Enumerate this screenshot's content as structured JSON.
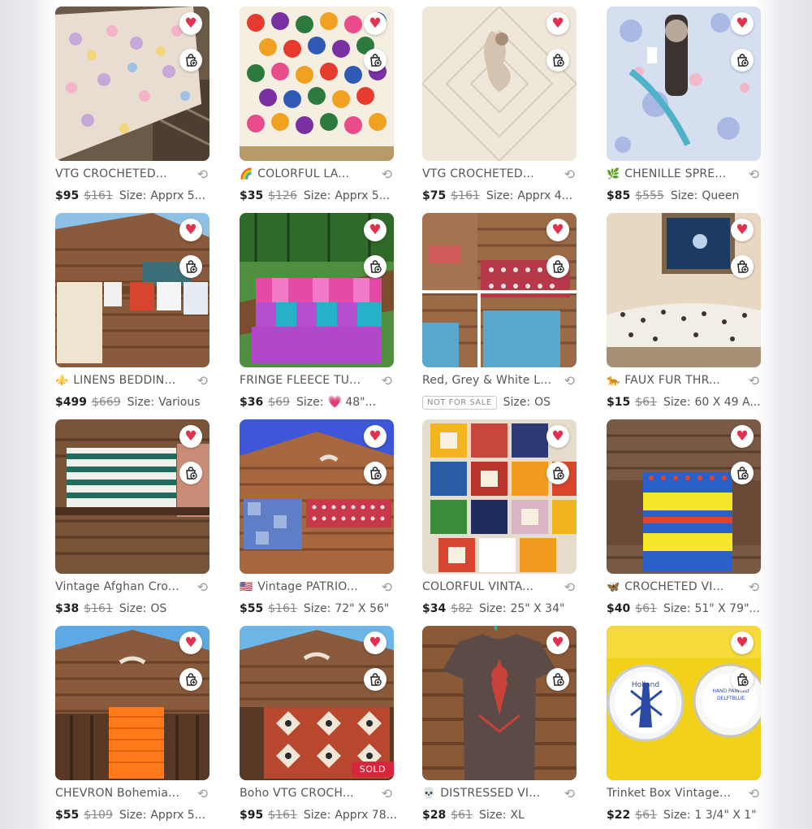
{
  "listings": [
    {
      "title": "VTG CROCHETED...",
      "emoji": "",
      "price": "$95",
      "original_price": "$161",
      "size_label": "Size:",
      "size": "Apprx 5...",
      "not_for_sale": "",
      "sold": ""
    },
    {
      "title": "COLORFUL  LA...",
      "emoji": "🌈",
      "price": "$35",
      "original_price": "$126",
      "size_label": "Size:",
      "size": "Apprx 5...",
      "not_for_sale": "",
      "sold": ""
    },
    {
      "title": "VTG CROCHETED...",
      "emoji": "",
      "price": "$75",
      "original_price": "$161",
      "size_label": "Size:",
      "size": "Apprx  4...",
      "not_for_sale": "",
      "sold": ""
    },
    {
      "title": "CHENILLE SPRE...",
      "emoji": "🌿",
      "price": "$85",
      "original_price": "$555",
      "size_label": "Size:",
      "size": "Queen",
      "not_for_sale": "",
      "sold": ""
    },
    {
      "title": "LINENS BEDDIN...",
      "emoji": "⚜️",
      "price": "$499",
      "original_price": "$669",
      "size_label": "Size:",
      "size": "Various",
      "not_for_sale": "",
      "sold": ""
    },
    {
      "title": "FRINGE FLEECE TU...",
      "emoji": "",
      "price": "$36",
      "original_price": "$69",
      "size_label": "Size:",
      "size": "💗    48\"...",
      "not_for_sale": "",
      "sold": ""
    },
    {
      "title": "Red, Grey & White L...",
      "emoji": "",
      "price": "",
      "original_price": "",
      "size_label": "Size:",
      "size": "OS",
      "not_for_sale": "NOT FOR SALE",
      "sold": ""
    },
    {
      "title": "FAUX FUR THR...",
      "emoji": "🐆",
      "price": "$15",
      "original_price": "$61",
      "size_label": "Size:",
      "size": "60 X 49 A...",
      "not_for_sale": "",
      "sold": ""
    },
    {
      "title": "Vintage Afghan Cro...",
      "emoji": "",
      "price": "$38",
      "original_price": "$161",
      "size_label": "Size:",
      "size": "OS",
      "not_for_sale": "",
      "sold": ""
    },
    {
      "title": "Vintage PATRIO...",
      "emoji": "🇺🇸",
      "price": "$55",
      "original_price": "$161",
      "size_label": "Size:",
      "size": "72\" X 56\"",
      "not_for_sale": "",
      "sold": ""
    },
    {
      "title": "COLORFUL  VINTA...",
      "emoji": "",
      "price": "$34",
      "original_price": "$82",
      "size_label": "Size:",
      "size": "25\" X 34\"",
      "not_for_sale": "",
      "sold": ""
    },
    {
      "title": "CROCHETED VI...",
      "emoji": "🦋",
      "price": "$40",
      "original_price": "$61",
      "size_label": "Size:",
      "size": "51\" X 79\"...",
      "not_for_sale": "",
      "sold": ""
    },
    {
      "title": "CHEVRON Bohemia...",
      "emoji": "",
      "price": "$55",
      "original_price": "$109",
      "size_label": "Size:",
      "size": "Apprx 5...",
      "not_for_sale": "",
      "sold": ""
    },
    {
      "title": "Boho VTG CROCH...",
      "emoji": "",
      "price": "$95",
      "original_price": "$161",
      "size_label": "Size:",
      "size": "Apprx 78...",
      "not_for_sale": "",
      "sold": "SOLD"
    },
    {
      "title": "DISTRESSED VI...",
      "emoji": "💀",
      "price": "$28",
      "original_price": "$61",
      "size_label": "Size:",
      "size": "XL",
      "not_for_sale": "",
      "sold": ""
    },
    {
      "title": "Trinket Box Vintage...",
      "emoji": "",
      "price": "$22",
      "original_price": "$61",
      "size_label": "Size:",
      "size": "1 3/4\"  X  1\"",
      "not_for_sale": "",
      "sold": ""
    }
  ],
  "thumb_image_text": {
    "trinket_box_left": "Holland",
    "trinket_box_right": "HAND PAINTED DELFTBLUE"
  },
  "colors": {
    "heart": "#e2304f",
    "sold_badge": "#d7263d",
    "price": "#1e1e1e",
    "muted_text": "#888888"
  }
}
